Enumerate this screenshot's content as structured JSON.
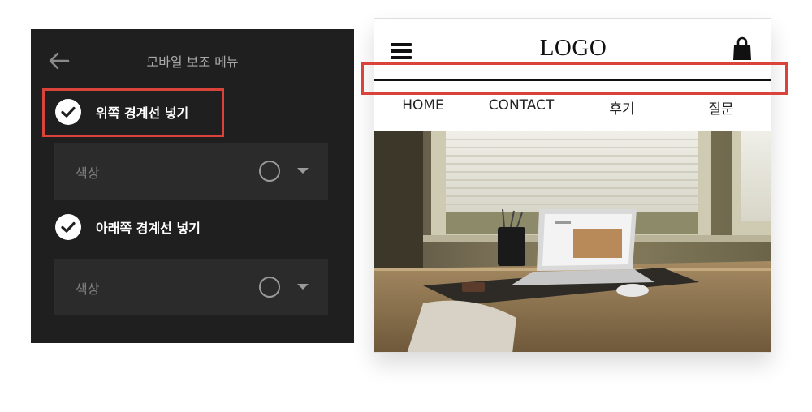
{
  "panel": {
    "title": "모바일 보조 메뉴",
    "back_icon": "arrow-left-icon",
    "options": [
      {
        "label": "위쪽 경계선 넣기",
        "checked": true,
        "color_label": "색상"
      },
      {
        "label": "아래쪽 경계선 넣기",
        "checked": true,
        "color_label": "색상"
      }
    ],
    "colors": {
      "background": "#1f1f1f",
      "row": "#2b2b2b",
      "highlight": "#d9433a"
    }
  },
  "preview": {
    "logo": "LOGO",
    "menu_icon": "hamburger-icon",
    "cart_icon": "shopping-bag-icon",
    "nav": [
      "HOME",
      "CONTACT",
      "후기",
      "질문"
    ],
    "hero_image": "desk-laptop-window-photo"
  }
}
